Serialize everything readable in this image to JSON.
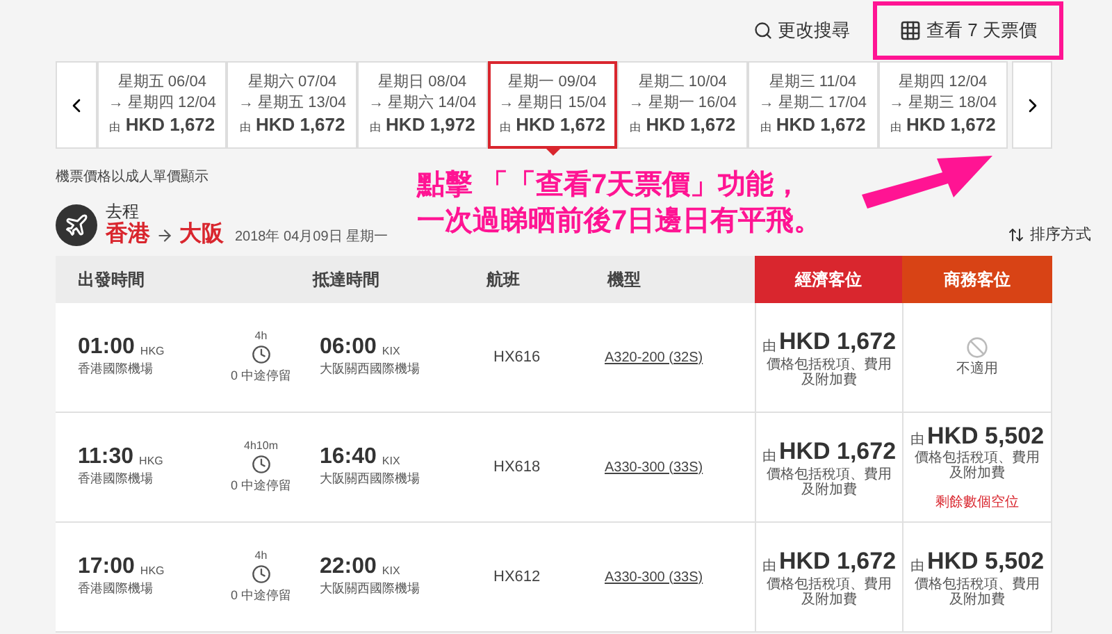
{
  "top_actions": [
    {
      "kind": "search",
      "label": "更改搜尋"
    },
    {
      "kind": "calendar",
      "label": "查看 7 天票價"
    }
  ],
  "date_strip": [
    {
      "depart": "星期五 06/04",
      "return": "→ 星期四 12/04",
      "prefix": "由",
      "price": "HKD 1,672",
      "selected": false
    },
    {
      "depart": "星期六 07/04",
      "return": "→ 星期五 13/04",
      "prefix": "由",
      "price": "HKD 1,672",
      "selected": false
    },
    {
      "depart": "星期日 08/04",
      "return": "→ 星期六 14/04",
      "prefix": "由",
      "price": "HKD 1,972",
      "selected": false
    },
    {
      "depart": "星期一 09/04",
      "return": "→ 星期日 15/04",
      "prefix": "由",
      "price": "HKD 1,672",
      "selected": true
    },
    {
      "depart": "星期二 10/04",
      "return": "→ 星期一 16/04",
      "prefix": "由",
      "price": "HKD 1,672",
      "selected": false
    },
    {
      "depart": "星期三 11/04",
      "return": "→ 星期二 17/04",
      "prefix": "由",
      "price": "HKD 1,672",
      "selected": false
    },
    {
      "depart": "星期四 12/04",
      "return": "→ 星期三 18/04",
      "prefix": "由",
      "price": "HKD 1,672",
      "selected": false
    }
  ],
  "price_note": "機票價格以成人單價顯示",
  "leg": {
    "label": "去程",
    "origin": "香港",
    "destination": "大阪",
    "date": "2018年 04月09日 星期一"
  },
  "sort": "排序方式",
  "annotation": {
    "lines": [
      "點擊 「「查看7天票價」功能，",
      "一次過睇晒前後7日邊日有平飛。"
    ]
  },
  "table": {
    "columns": [
      "出發時間",
      "抵達時間",
      "航班",
      "機型",
      "經濟客位",
      "商務客位"
    ],
    "rows": [
      {
        "depart_time": "01:00",
        "depart_code": "HKG",
        "depart_airport": "香港國際機場",
        "duration": "4h",
        "stops": "0 中途停留",
        "arrive_time": "06:00",
        "arrive_code": "KIX",
        "arrive_airport": "大阪關西國際機場",
        "flight": "HX616",
        "aircraft": "A320-200 (32S)",
        "economy": {
          "kind": "price",
          "prefix": "由",
          "price": "HKD 1,672",
          "note": "價格包括稅項、費用及附加費"
        },
        "business": {
          "kind": "unavailable",
          "label": "不適用"
        }
      },
      {
        "depart_time": "11:30",
        "depart_code": "HKG",
        "depart_airport": "香港國際機場",
        "duration": "4h10m",
        "stops": "0 中途停留",
        "arrive_time": "16:40",
        "arrive_code": "KIX",
        "arrive_airport": "大阪關西國際機場",
        "flight": "HX618",
        "aircraft": "A330-300 (33S)",
        "economy": {
          "kind": "price",
          "prefix": "由",
          "price": "HKD 1,672",
          "note": "價格包括稅項、費用及附加費"
        },
        "business": {
          "kind": "price",
          "prefix": "由",
          "price": "HKD 5,502",
          "note": "價格包括稅項、費用及附加費",
          "seats": "剩餘數個空位"
        }
      },
      {
        "depart_time": "17:00",
        "depart_code": "HKG",
        "depart_airport": "香港國際機場",
        "duration": "4h",
        "stops": "0 中途停留",
        "arrive_time": "22:00",
        "arrive_code": "KIX",
        "arrive_airport": "大阪關西國際機場",
        "flight": "HX612",
        "aircraft": "A330-300 (33S)",
        "economy": {
          "kind": "price",
          "prefix": "由",
          "price": "HKD 1,672",
          "note": "價格包括稅項、費用及附加費"
        },
        "business": {
          "kind": "price",
          "prefix": "由",
          "price": "HKD 5,502",
          "note": "價格包括稅項、費用及附加費"
        }
      }
    ]
  }
}
